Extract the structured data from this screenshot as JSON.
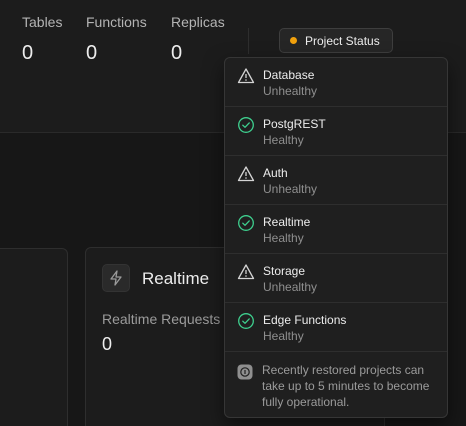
{
  "stats": [
    {
      "label": "Tables",
      "value": "0"
    },
    {
      "label": "Functions",
      "value": "0"
    },
    {
      "label": "Replicas",
      "value": "0"
    }
  ],
  "status_button": {
    "label": "Project Status",
    "dot_color": "#f1a10d"
  },
  "realtime_card": {
    "title": "Realtime",
    "metric_label": "Realtime Requests",
    "metric_value": "0",
    "icon": "bolt-icon"
  },
  "services": [
    {
      "name": "Database",
      "status": "Unhealthy",
      "icon": "warning-icon"
    },
    {
      "name": "PostgREST",
      "status": "Healthy",
      "icon": "check-circle-icon"
    },
    {
      "name": "Auth",
      "status": "Unhealthy",
      "icon": "warning-icon"
    },
    {
      "name": "Realtime",
      "status": "Healthy",
      "icon": "check-circle-icon"
    },
    {
      "name": "Storage",
      "status": "Unhealthy",
      "icon": "warning-icon"
    },
    {
      "name": "Edge Functions",
      "status": "Healthy",
      "icon": "check-circle-icon"
    }
  ],
  "note": {
    "text": "Recently restored projects can take up to 5 minutes to become fully operational.",
    "icon": "info-icon"
  },
  "colors": {
    "healthy": "#3ecf8e",
    "warning": "#d4d4d4",
    "accent_dot": "#f1a10d"
  }
}
